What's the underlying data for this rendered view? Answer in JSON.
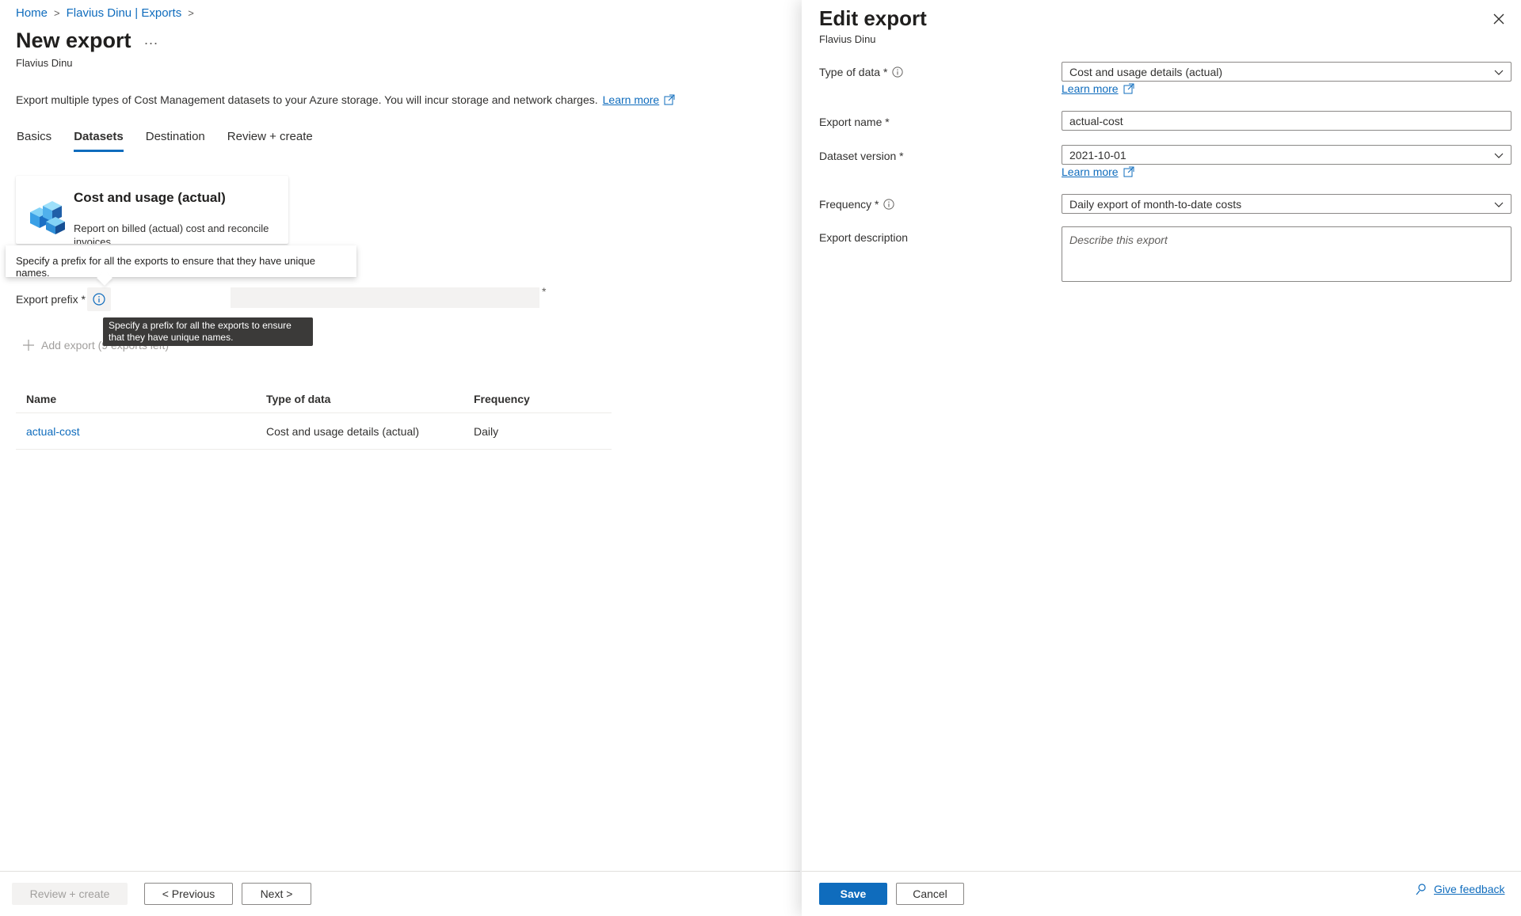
{
  "breadcrumb": {
    "items": [
      "Home",
      "Flavius Dinu | Exports"
    ]
  },
  "left": {
    "title": "New export",
    "more": "...",
    "subtitle": "Flavius Dinu",
    "description": "Export multiple types of Cost Management datasets to your Azure storage. You will incur storage and network charges.",
    "learn_more": "Learn more",
    "tabs": [
      {
        "label": "Basics",
        "active": false
      },
      {
        "label": "Datasets",
        "active": true
      },
      {
        "label": "Destination",
        "active": false
      },
      {
        "label": "Review + create",
        "active": false
      }
    ],
    "card": {
      "title": "Cost and usage (actual)",
      "description": "Report on billed (actual) cost and reconcile invoices."
    },
    "tooltip_light": "Specify a prefix for all the exports to ensure that they have unique names.",
    "prefix": {
      "label": "Export prefix *",
      "value": "",
      "required_marker": "*"
    },
    "tooltip_dark": "Specify a prefix for all the exports to ensure that they have unique names.",
    "add_export": "Add export (9 exports left)",
    "table": {
      "headers": [
        "Name",
        "Type of data",
        "Frequency"
      ],
      "rows": [
        {
          "name": "actual-cost",
          "type": "Cost and usage details (actual)",
          "frequency": "Daily"
        }
      ]
    },
    "footer": {
      "review_create": "Review + create",
      "previous": "< Previous",
      "next": "Next >"
    }
  },
  "panel": {
    "title": "Edit export",
    "subtitle": "Flavius Dinu",
    "fields": {
      "type_of_data": {
        "label": "Type of data *",
        "value": "Cost and usage details (actual)",
        "learn_more": "Learn more"
      },
      "export_name": {
        "label": "Export name *",
        "value": "actual-cost"
      },
      "dataset_version": {
        "label": "Dataset version *",
        "value": "2021-10-01",
        "learn_more": "Learn more"
      },
      "frequency": {
        "label": "Frequency *",
        "value": "Daily export of month-to-date costs"
      },
      "export_description": {
        "label": "Export description",
        "placeholder": "Describe this export"
      }
    },
    "footer": {
      "save": "Save",
      "cancel": "Cancel",
      "feedback": "Give feedback"
    }
  },
  "colors": {
    "accent": "#0f6cbd",
    "tooltip_dark": "#3b3a39"
  }
}
